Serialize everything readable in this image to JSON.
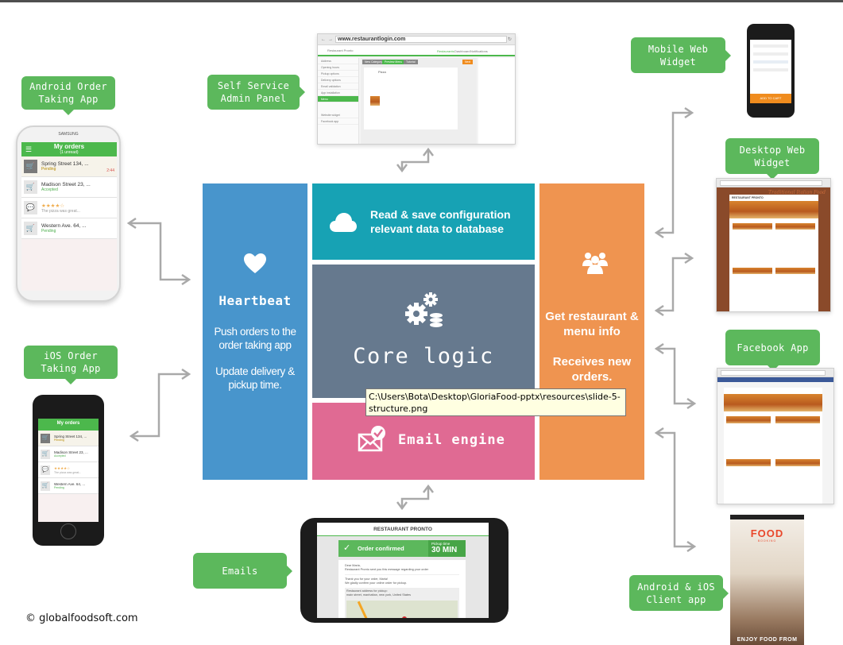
{
  "colors": {
    "callout_green": "#5cb85c",
    "heartbeat_blue": "#4895cc",
    "database_teal": "#17a2b4",
    "core_slate": "#66798e",
    "email_pink": "#e06a93",
    "restaurant_orange": "#ef9450",
    "arrow_gray": "#a9a9a9"
  },
  "callouts": {
    "android_order": "Android Order Taking App",
    "ios_order": "iOS Order Taking App",
    "admin_panel": "Self Service Admin Panel",
    "mobile_widget": "Mobile Web Widget",
    "desktop_widget": "Desktop Web Widget",
    "facebook_app": "Facebook App",
    "client_app": "Android & iOS Client app",
    "emails": "Emails"
  },
  "tiles": {
    "heartbeat": {
      "icon": "heart-icon",
      "title": "Heartbeat",
      "line1": "Push orders to the order taking app",
      "line2": "Update delivery & pickup time."
    },
    "database": {
      "icon": "cloud-icon",
      "text": "Read & save configuration relevant data to database"
    },
    "core": {
      "icon": "gears-database-icon",
      "title": "Core logic"
    },
    "email": {
      "icon": "email-check-icon",
      "title": "Email engine"
    },
    "restaurant": {
      "icon": "users-icon",
      "line1": "Get restaurant & menu info",
      "line2": "Receives new orders."
    }
  },
  "tooltip": "C:\\Users\\Bota\\Desktop\\GloriaFood-pptx\\resources\\slide-5-structure.png",
  "order_app": {
    "brand": "SAMSUNG",
    "title": "My orders",
    "subtitle": "(1 unread)",
    "orders": [
      {
        "icon": "cart-icon",
        "line1": "Spring Street 134, ...",
        "status": "Pending",
        "timer": "2:44",
        "highlight": true
      },
      {
        "icon": "cart-icon",
        "line1": "Madison Street 23, ...",
        "status": "Accepted",
        "timer": "",
        "highlight": false
      },
      {
        "icon": "comment-icon",
        "line1": "★★★★☆",
        "status": "The pizza was great...",
        "timer": "",
        "highlight": false
      },
      {
        "icon": "cart-icon",
        "line1": "Western Ave. 64, ...",
        "status": "Pending",
        "timer": "",
        "highlight": false
      }
    ]
  },
  "admin_panel": {
    "url": "www.restaurantlogin.com",
    "restaurant": "Restaurant Pronto",
    "nav": [
      "Restaurants",
      "Dashboard",
      "Notifications"
    ],
    "side_items": [
      "Address",
      "Opening hours",
      "Pickup options",
      "Delivery options",
      "Email validation",
      "App installation",
      "Menu"
    ],
    "side_extra": [
      "Website widget",
      "Facebook app"
    ],
    "buttons": [
      "New Category",
      "Preview Menu",
      "Tutorial",
      "Next"
    ],
    "category": "Pizza"
  },
  "email": {
    "restaurant": "RESTAURANT PRONTO",
    "status": "Order confirmed",
    "pickup_label": "Pickup time",
    "pickup_value": "30 MIN",
    "greeting": "Dear Maria,",
    "intro": "Restaurant Pronto sent you this message regarding your order",
    "thanks": "Thank you for your order, Maria!",
    "confirm": "We gladly confirm your online order for pickup.",
    "address_label": "Restaurant address for pickup:",
    "address": "main street, manhattan, new york, United States"
  },
  "mobile_widget": {
    "cta": "ADD TO CART"
  },
  "desktop_widget": {
    "heading": "Traditional Italian Food",
    "menu_title": "RESTAURANT PRONTO"
  },
  "client_app": {
    "logo": "FOOD",
    "logo_sub": "BOOKING",
    "tagline": "ENJOY FOOD FROM"
  },
  "footer": {
    "copyright": "© globalfoodsoft.com"
  }
}
